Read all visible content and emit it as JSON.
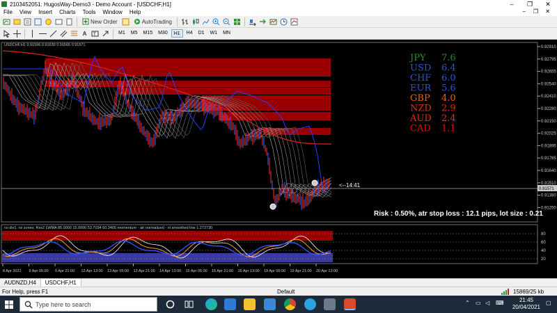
{
  "window": {
    "title": "2103452051: HugosWay-Demo3 - Demo Account - [USDCHF,H1]",
    "controls": [
      "–",
      "❐",
      "✕"
    ],
    "inner_controls": [
      "–",
      "❐",
      "✕"
    ]
  },
  "menu": [
    "File",
    "View",
    "Insert",
    "Charts",
    "Tools",
    "Window",
    "Help"
  ],
  "toolbar": {
    "new_order": "New Order",
    "autotrading": "AutoTrading"
  },
  "timeframes": [
    "M1",
    "M5",
    "M15",
    "M30",
    "H1",
    "H4",
    "D1",
    "W1",
    "MN"
  ],
  "active_timeframe": "H1",
  "chart": {
    "info": "USDCHF,H1  0.91596 0.91630 0.91565 0.91571",
    "price_labels": [
      "0.92910",
      "0.92795",
      "0.92655",
      "0.92540",
      "0.92410",
      "0.92280",
      "0.92150",
      "0.92025",
      "0.91895",
      "0.91765",
      "0.91640",
      "0.91510",
      "0.91380",
      "0.91250"
    ],
    "current_price": "0.91571",
    "countdown": "<--14:41",
    "strength": [
      {
        "cur": "JPY",
        "val": "7.6",
        "color": "#2e8b2e"
      },
      {
        "cur": "USD",
        "val": "6.4",
        "color": "#2f56c8"
      },
      {
        "cur": "CHF",
        "val": "6.0",
        "color": "#2f56c8"
      },
      {
        "cur": "EUR",
        "val": "5.6",
        "color": "#2f56c8"
      },
      {
        "cur": "GBP",
        "val": "4.0",
        "color": "#e06a10"
      },
      {
        "cur": "NZD",
        "val": "2.9",
        "color": "#e03010"
      },
      {
        "cur": "AUD",
        "val": "2.4",
        "color": "#e03010"
      },
      {
        "cur": "CAD",
        "val": "1.1",
        "color": "#e01010"
      }
    ],
    "risk_text": "Risk : 0.50%, atr stop loss : 12.1 pips, lot size : 0.21",
    "indicator_info": "rsi div1: rsi zones: Rsx2 LWMA 85.0000 15.0000 53.7034 60.3405  momentum - atr normalized - nl smoothed line 1.272730",
    "indicator_levels": [
      "80",
      "60",
      "40",
      "20"
    ],
    "date_labels": [
      "8 Apr 2021",
      "9 Apr 05:00",
      "9 Apr 21:00",
      "12 Apr 13:00",
      "13 Apr 05:00",
      "13 Apr 21:00",
      "14 Apr 13:00",
      "15 Apr 05:00",
      "15 Apr 21:00",
      "16 Apr 13:00",
      "19 Apr 05:00",
      "19 Apr 21:00",
      "20 Apr 13:00"
    ]
  },
  "tabs": [
    "AUDNZD,H4",
    "USDCHF,H1"
  ],
  "active_tab": "USDCHF,H1",
  "status": {
    "help": "For Help, press F1",
    "profile": "Default",
    "traffic": "15869/25 kb"
  },
  "taskbar": {
    "search_placeholder": "Type here to search",
    "time": "21:45",
    "date": "20/04/2021"
  }
}
